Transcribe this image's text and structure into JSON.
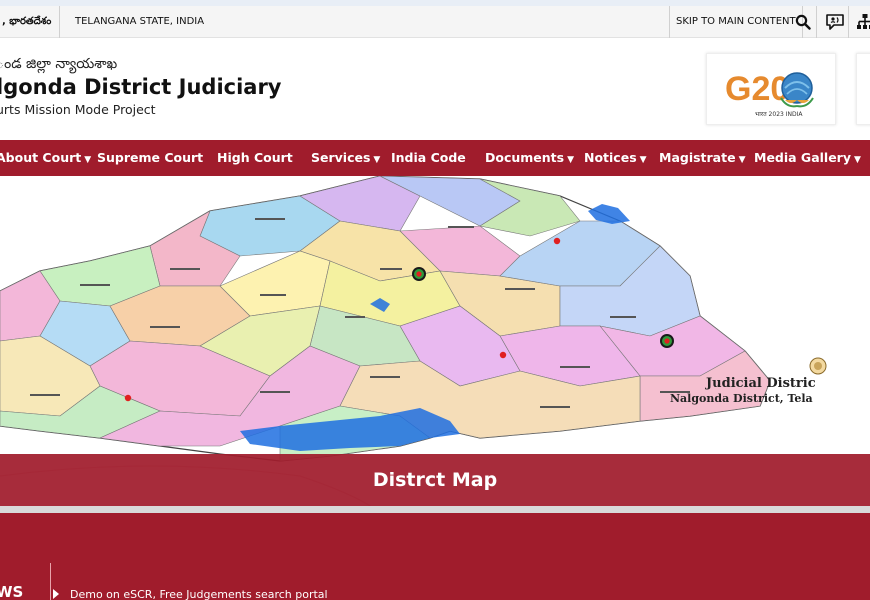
{
  "topbar": {
    "language": ", భారతదేశం",
    "state": "TELANGANA STATE, INDIA",
    "skip_link": "SKIP TO MAIN CONTENT",
    "icons": [
      "search-icon",
      "screen-reader-icon",
      "sitemap-icon"
    ]
  },
  "header": {
    "title_telugu": "ండ జిల్లా న్యాయశాఖ",
    "title": "lgonda District Judiciary",
    "subtitle": "urts Mission Mode Project",
    "g20_logo": "G20",
    "g20_caption": "भारत 2023 INDIA"
  },
  "nav": {
    "items": [
      {
        "label": "About Court",
        "dropdown": true
      },
      {
        "label": "Supreme Court",
        "dropdown": false
      },
      {
        "label": "High Court",
        "dropdown": false
      },
      {
        "label": "Services",
        "dropdown": true
      },
      {
        "label": "India Code",
        "dropdown": false
      },
      {
        "label": "Documents",
        "dropdown": true
      },
      {
        "label": "Notices",
        "dropdown": true
      },
      {
        "label": "Magistrate",
        "dropdown": true
      },
      {
        "label": "Media Gallery",
        "dropdown": true
      }
    ]
  },
  "banner": {
    "map_heading": "Judicial Distric",
    "map_subheading": "Nalgonda District, Tela",
    "caption": "Distrct Map"
  },
  "news": {
    "label": "WS",
    "ticker": "Demo on eSCR, Free Judgements search portal"
  },
  "colors": {
    "brand": "#a01c2c",
    "topbar_bg": "#f5f5f5",
    "text": "#111111"
  }
}
